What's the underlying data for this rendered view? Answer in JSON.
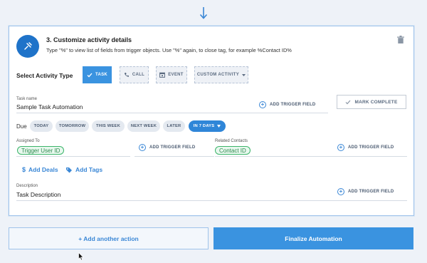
{
  "step": {
    "title": "3. Customize activity details",
    "subtitle": "Type \"%\" to view list of fields from trigger objects. Use \"%\" again, to close tag, for example %Contact ID%"
  },
  "activity": {
    "label": "Select Activity Type",
    "types": [
      "TASK",
      "CALL",
      "EVENT",
      "CUSTOM ACTIVITY"
    ],
    "selected": "TASK"
  },
  "task_name": {
    "label": "Task name",
    "value": "Sample Task Automation"
  },
  "add_trigger_label": "ADD TRIGGER FIELD",
  "mark_complete_label": "MARK COMPLETE",
  "due": {
    "label": "Due",
    "options": [
      "TODAY",
      "TOMORROW",
      "THIS WEEK",
      "NEXT WEEK",
      "LATER",
      "IN 7 DAYS"
    ],
    "selected": "IN 7 DAYS"
  },
  "assigned_to": {
    "label": "Assigned To",
    "value": "Trigger User ID"
  },
  "related_contacts": {
    "label": "Related Contacts",
    "value": "Contact ID"
  },
  "links": {
    "add_deals": "Add Deals",
    "add_tags": "Add Tags"
  },
  "description": {
    "label": "Description",
    "value": "Task Description"
  },
  "footer": {
    "add_another": "+ Add another action",
    "finalize": "Finalize Automation"
  },
  "colors": {
    "accent": "#3a93e0",
    "tag_green": "#3bb56a"
  }
}
